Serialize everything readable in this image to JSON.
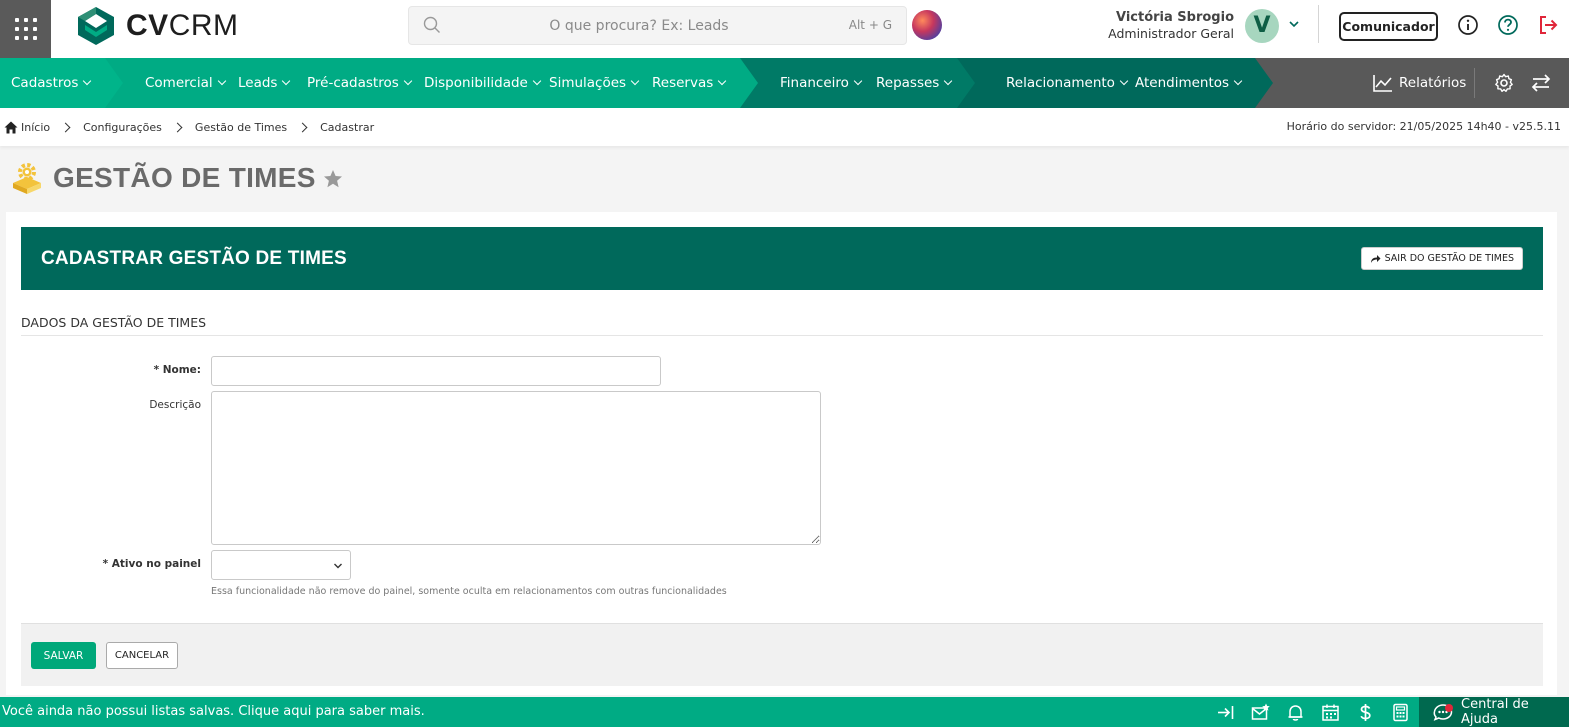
{
  "brand": {
    "name_bold": "CV",
    "name_regular": "CRM"
  },
  "search": {
    "placeholder": "O que procura? Ex: Leads",
    "shortcut": "Alt + G"
  },
  "user": {
    "name": "Victória Sbrogio",
    "role": "Administrador Geral",
    "initial": "V"
  },
  "topbar": {
    "comunicador_label": "Comunicador"
  },
  "nav": {
    "cadastros": "Cadastros",
    "comercial": "Comercial",
    "leads": "Leads",
    "pre_cadastros": "Pré-cadastros",
    "disponibilidade": "Disponibilidade",
    "simulacoes": "Simulações",
    "reservas": "Reservas",
    "financeiro": "Financeiro",
    "repasses": "Repasses",
    "relacionamento": "Relacionamento",
    "atendimentos": "Atendimentos",
    "relatorios": "Relatórios"
  },
  "breadcrumb": {
    "home": "Início",
    "level1": "Configurações",
    "level2": "Gestão de Times",
    "current": "Cadastrar"
  },
  "server_time": "Horário do servidor: 21/05/2025 14h40 - v25.5.11",
  "page": {
    "title": "GESTÃO DE TIMES"
  },
  "form": {
    "header_title": "CADASTRAR GESTÃO DE TIMES",
    "exit_button": "SAIR DO GESTÃO DE TIMES",
    "section_title": "DADOS DA GESTÃO DE TIMES",
    "nome_label": "* Nome:",
    "nome_value": "",
    "descricao_label": "Descrição",
    "descricao_value": "",
    "ativo_label": "* Ativo no painel",
    "ativo_value": "",
    "help_text": "Essa funcionalidade não remove do painel, somente oculta em relacionamentos com outras funcionalidades",
    "save_button": "SALVAR",
    "cancel_button": "CANCELAR"
  },
  "statusbar": {
    "message": "Você ainda não possui listas salvas. Clique aqui para saber mais.",
    "help_center": "Central de Ajuda"
  },
  "colors": {
    "brand_green": "#00ab84",
    "dark_green": "#00695b",
    "nav_gray": "#595959",
    "logout_red": "#e0263a"
  }
}
